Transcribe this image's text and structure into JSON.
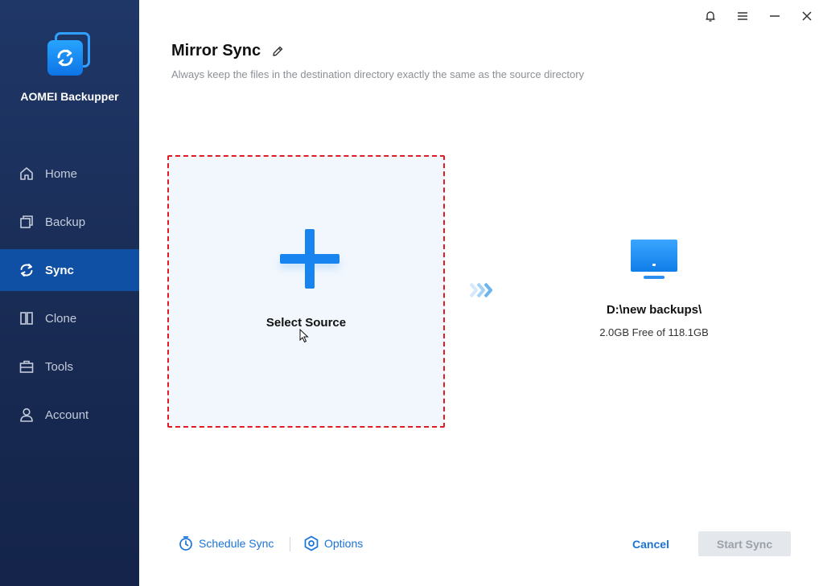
{
  "app": {
    "name": "AOMEI Backupper"
  },
  "sidebar": {
    "items": [
      {
        "label": "Home",
        "icon": "home-icon",
        "active": false
      },
      {
        "label": "Backup",
        "icon": "backup-icon",
        "active": false
      },
      {
        "label": "Sync",
        "icon": "sync-icon",
        "active": true
      },
      {
        "label": "Clone",
        "icon": "clone-icon",
        "active": false
      },
      {
        "label": "Tools",
        "icon": "tools-icon",
        "active": false
      },
      {
        "label": "Account",
        "icon": "account-icon",
        "active": false
      }
    ]
  },
  "titlebar": {
    "icons": [
      "bell-icon",
      "menu-icon",
      "minimize-icon",
      "close-icon"
    ]
  },
  "header": {
    "title": "Mirror Sync",
    "subtitle": "Always keep the files in the destination directory exactly the same as the source directory"
  },
  "source": {
    "label": "Select Source"
  },
  "destination": {
    "path": "D:\\new backups\\",
    "free": "2.0GB Free of 118.1GB"
  },
  "footer": {
    "schedule_label": "Schedule Sync",
    "options_label": "Options",
    "cancel_label": "Cancel",
    "start_label": "Start Sync"
  },
  "colors": {
    "sidebar_bg": "#1b3060",
    "active_nav": "#0f4fa4",
    "accent": "#1784f0",
    "dashed_border": "#e01b24",
    "link": "#1a73d8"
  }
}
